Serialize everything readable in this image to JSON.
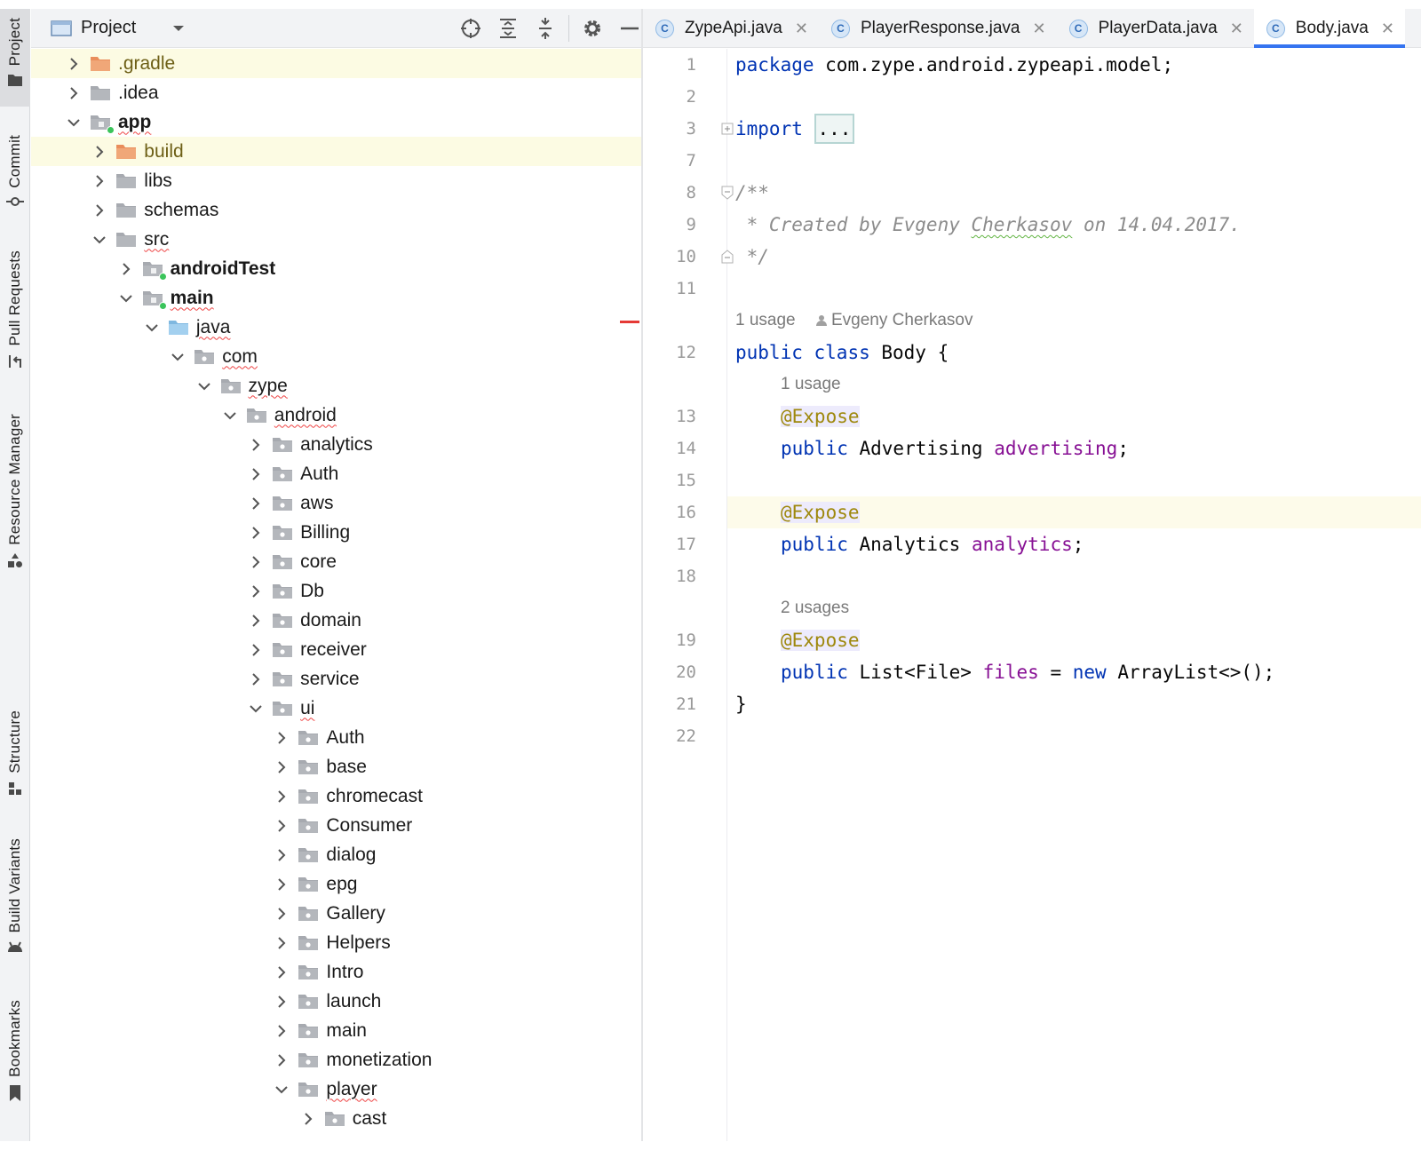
{
  "tool_strip": {
    "items": [
      {
        "key": "project",
        "label": "Project",
        "icon": "folder-icon",
        "active": true
      },
      {
        "key": "commit",
        "label": "Commit",
        "icon": "commit-icon"
      },
      {
        "key": "pull_requests",
        "label": "Pull Requests",
        "icon": "pull-request-icon"
      },
      {
        "key": "resource_manager",
        "label": "Resource Manager",
        "icon": "resource-manager-icon"
      },
      {
        "key": "structure",
        "label": "Structure",
        "icon": "structure-icon"
      },
      {
        "key": "build_variants",
        "label": "Build Variants",
        "icon": "android-icon"
      },
      {
        "key": "bookmarks",
        "label": "Bookmarks",
        "icon": "bookmark-icon"
      }
    ]
  },
  "project_panel": {
    "title": "Project",
    "toolbar": [
      "locate-icon",
      "expand-all-icon",
      "collapse-all-icon",
      "settings-icon",
      "hide-icon"
    ],
    "tree": [
      {
        "label": ".gradle",
        "depth": 0,
        "expanded": false,
        "folder": "excluded",
        "highlight": true
      },
      {
        "label": ".idea",
        "depth": 0,
        "expanded": false,
        "folder": "plain"
      },
      {
        "label": "app",
        "depth": 0,
        "expanded": true,
        "folder": "module",
        "bold": true,
        "squiggle": true
      },
      {
        "label": "build",
        "depth": 1,
        "expanded": false,
        "folder": "excluded",
        "highlight": true
      },
      {
        "label": "libs",
        "depth": 1,
        "expanded": false,
        "folder": "plain"
      },
      {
        "label": "schemas",
        "depth": 1,
        "expanded": false,
        "folder": "plain"
      },
      {
        "label": "src",
        "depth": 1,
        "expanded": true,
        "folder": "plain",
        "squiggle": true
      },
      {
        "label": "androidTest",
        "depth": 2,
        "expanded": false,
        "folder": "module",
        "bold": true
      },
      {
        "label": "main",
        "depth": 2,
        "expanded": true,
        "folder": "module",
        "bold": true,
        "squiggle": true
      },
      {
        "label": "java",
        "depth": 3,
        "expanded": true,
        "folder": "source",
        "squiggle": true
      },
      {
        "label": "com",
        "depth": 4,
        "expanded": true,
        "folder": "package",
        "squiggle": true
      },
      {
        "label": "zype",
        "depth": 5,
        "expanded": true,
        "folder": "package",
        "squiggle": true
      },
      {
        "label": "android",
        "depth": 6,
        "expanded": true,
        "folder": "package",
        "squiggle": true
      },
      {
        "label": "analytics",
        "depth": 7,
        "expanded": false,
        "folder": "package"
      },
      {
        "label": "Auth",
        "depth": 7,
        "expanded": false,
        "folder": "package"
      },
      {
        "label": "aws",
        "depth": 7,
        "expanded": false,
        "folder": "package"
      },
      {
        "label": "Billing",
        "depth": 7,
        "expanded": false,
        "folder": "package"
      },
      {
        "label": "core",
        "depth": 7,
        "expanded": false,
        "folder": "package"
      },
      {
        "label": "Db",
        "depth": 7,
        "expanded": false,
        "folder": "package"
      },
      {
        "label": "domain",
        "depth": 7,
        "expanded": false,
        "folder": "package"
      },
      {
        "label": "receiver",
        "depth": 7,
        "expanded": false,
        "folder": "package"
      },
      {
        "label": "service",
        "depth": 7,
        "expanded": false,
        "folder": "package"
      },
      {
        "label": "ui",
        "depth": 7,
        "expanded": true,
        "folder": "package",
        "squiggle": true
      },
      {
        "label": "Auth",
        "depth": 8,
        "expanded": false,
        "folder": "package"
      },
      {
        "label": "base",
        "depth": 8,
        "expanded": false,
        "folder": "package"
      },
      {
        "label": "chromecast",
        "depth": 8,
        "expanded": false,
        "folder": "package"
      },
      {
        "label": "Consumer",
        "depth": 8,
        "expanded": false,
        "folder": "package"
      },
      {
        "label": "dialog",
        "depth": 8,
        "expanded": false,
        "folder": "package"
      },
      {
        "label": "epg",
        "depth": 8,
        "expanded": false,
        "folder": "package"
      },
      {
        "label": "Gallery",
        "depth": 8,
        "expanded": false,
        "folder": "package"
      },
      {
        "label": "Helpers",
        "depth": 8,
        "expanded": false,
        "folder": "package"
      },
      {
        "label": "Intro",
        "depth": 8,
        "expanded": false,
        "folder": "package"
      },
      {
        "label": "launch",
        "depth": 8,
        "expanded": false,
        "folder": "package"
      },
      {
        "label": "main",
        "depth": 8,
        "expanded": false,
        "folder": "package"
      },
      {
        "label": "monetization",
        "depth": 8,
        "expanded": false,
        "folder": "package"
      },
      {
        "label": "player",
        "depth": 8,
        "expanded": true,
        "folder": "package",
        "squiggle": true
      },
      {
        "label": "cast",
        "depth": 9,
        "expanded": false,
        "folder": "package"
      }
    ]
  },
  "editor_tabs": [
    {
      "label": "ZypeApi.java",
      "badge": "C",
      "active": false
    },
    {
      "label": "PlayerResponse.java",
      "badge": "C",
      "active": false
    },
    {
      "label": "PlayerData.java",
      "badge": "C",
      "active": false
    },
    {
      "label": "Body.java",
      "badge": "C",
      "active": true
    }
  ],
  "editor": {
    "current_line": "16",
    "lines": [
      {
        "num": "1",
        "segs": [
          {
            "t": "package",
            "c": "kw"
          },
          {
            "t": " com.zype.android.zypeapi.model;"
          }
        ]
      },
      {
        "num": "2",
        "segs": []
      },
      {
        "num": "3",
        "fold": "plus",
        "segs": [
          {
            "t": "import",
            "c": "kw"
          },
          {
            "t": " "
          },
          {
            "t": "...",
            "c": "foldbox"
          }
        ]
      },
      {
        "num": "7",
        "segs": []
      },
      {
        "num": "8",
        "fold": "open",
        "segs": [
          {
            "t": "/**",
            "c": "cmt"
          }
        ]
      },
      {
        "num": "9",
        "segs": [
          {
            "t": " * Created by Evgeny ",
            "c": "cmt"
          },
          {
            "t": "Cherkasov",
            "c": "cmt squig-g"
          },
          {
            "t": " on 14.04.2017.",
            "c": "cmt"
          }
        ]
      },
      {
        "num": "10",
        "fold": "close",
        "segs": [
          {
            "t": " */",
            "c": "cmt"
          }
        ]
      },
      {
        "num": "11",
        "segs": []
      },
      {
        "inlay": "1 usage",
        "author": "Evgeny Cherkasov",
        "indent": 0
      },
      {
        "num": "12",
        "segs": [
          {
            "t": "public",
            "c": "kw"
          },
          {
            "t": " "
          },
          {
            "t": "class",
            "c": "kw"
          },
          {
            "t": " Body {"
          }
        ]
      },
      {
        "inlay": "1 usage",
        "indent": 1
      },
      {
        "num": "13",
        "indent": 1,
        "segs": [
          {
            "t": "@Expose",
            "c": "ann"
          }
        ]
      },
      {
        "num": "14",
        "indent": 1,
        "segs": [
          {
            "t": "public",
            "c": "kw"
          },
          {
            "t": " Advertising "
          },
          {
            "t": "advertising",
            "c": "fld"
          },
          {
            "t": ";"
          }
        ]
      },
      {
        "num": "15",
        "segs": []
      },
      {
        "num": "16",
        "indent": 1,
        "segs": [
          {
            "t": "@Expose",
            "c": "ann"
          }
        ]
      },
      {
        "num": "17",
        "indent": 1,
        "segs": [
          {
            "t": "public",
            "c": "kw"
          },
          {
            "t": " Analytics "
          },
          {
            "t": "analytics",
            "c": "fld"
          },
          {
            "t": ";"
          }
        ]
      },
      {
        "num": "18",
        "segs": []
      },
      {
        "inlay": "2 usages",
        "indent": 1
      },
      {
        "num": "19",
        "indent": 1,
        "segs": [
          {
            "t": "@Expose",
            "c": "ann"
          }
        ]
      },
      {
        "num": "20",
        "indent": 1,
        "segs": [
          {
            "t": "public",
            "c": "kw"
          },
          {
            "t": " List<File> "
          },
          {
            "t": "files",
            "c": "fld"
          },
          {
            "t": " = "
          },
          {
            "t": "new",
            "c": "kw"
          },
          {
            "t": " ArrayList<>();"
          }
        ]
      },
      {
        "num": "21",
        "segs": [
          {
            "t": "}"
          }
        ]
      },
      {
        "num": "22",
        "segs": []
      }
    ]
  },
  "colors": {
    "keyword": "#0033b3",
    "comment": "#8c8c8c",
    "annotation": "#9e880d",
    "field": "#871094",
    "tab_underline": "#3574f0",
    "module_dot": "#3bc45b"
  }
}
